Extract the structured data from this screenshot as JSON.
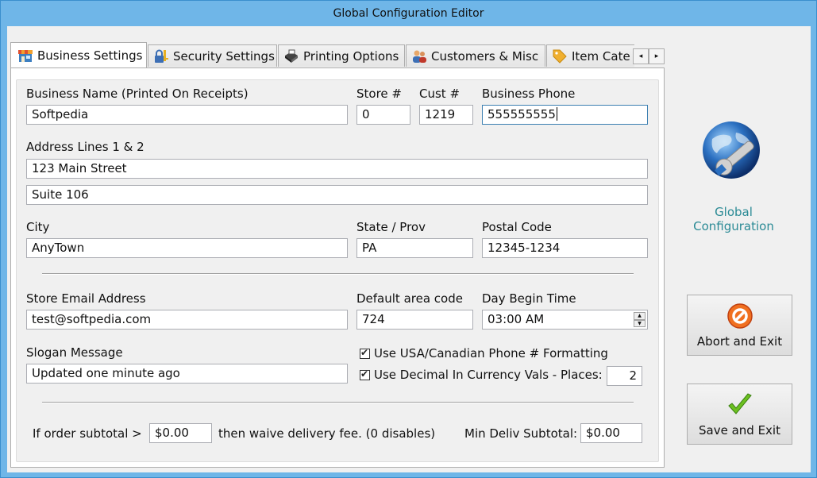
{
  "window": {
    "title": "Global Configuration Editor"
  },
  "tabs": [
    {
      "label": "Business Settings",
      "icon": "store-icon",
      "active": true
    },
    {
      "label": "Security Settings",
      "icon": "lock-key-icon"
    },
    {
      "label": "Printing Options",
      "icon": "printer-icon"
    },
    {
      "label": "Customers & Misc",
      "icon": "users-icon"
    },
    {
      "label": "Item Cate",
      "icon": "tag-icon"
    }
  ],
  "tab_scroll": {
    "left": "◂",
    "right": "▸"
  },
  "business": {
    "name_label": "Business Name (Printed On Receipts)",
    "name_value": "Softpedia",
    "store_label": "Store #",
    "store_value": "0",
    "cust_label": "Cust #",
    "cust_value": "1219",
    "phone_label": "Business Phone",
    "phone_value": "555555555",
    "address_label": "Address Lines 1 & 2",
    "address1_value": "123 Main Street",
    "address2_value": "Suite 106",
    "city_label": "City",
    "city_value": "AnyTown",
    "state_label": "State / Prov",
    "state_value": "PA",
    "postal_label": "Postal Code",
    "postal_value": "12345-1234",
    "email_label": "Store Email Address",
    "email_value": "test@softpedia.com",
    "area_label": "Default area code",
    "area_value": "724",
    "daybegin_label": "Day Begin Time",
    "daybegin_value": "03:00 AM",
    "slogan_label": "Slogan Message",
    "slogan_value": "Updated one minute ago",
    "phone_format_label": "Use USA/Canadian Phone # Formatting",
    "decimal_label": "Use Decimal In Currency Vals - Places:",
    "decimal_places": "2",
    "delivery_prefix": "If order subtotal >",
    "delivery_value": "$0.00",
    "delivery_suffix": "then waive delivery fee. (0 disables)",
    "min_deliv_label": "Min Deliv Subtotal:",
    "min_deliv_value": "$0.00"
  },
  "sidebar": {
    "logo_label": "Global Configuration",
    "abort_label": "Abort and Exit",
    "save_label": "Save and Exit"
  },
  "colors": {
    "accent_text": "#2a8a95",
    "titlebar": "#6fb6e8"
  }
}
